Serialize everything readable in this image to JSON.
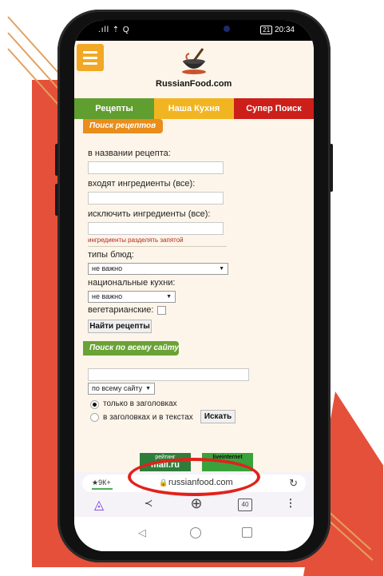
{
  "status_bar": {
    "signal": ".ıll ⇡ Q",
    "battery": "21",
    "time": "20:34"
  },
  "site": {
    "logo_text": "RussianFood.com",
    "nav_tabs": [
      "Рецепты",
      "Наша Кухня",
      "Супер Поиск"
    ],
    "search_recipes": {
      "title": "Поиск рецептов",
      "name_label": "в названии рецепта:",
      "ingredients_label": "входят ингредиенты (все):",
      "exclude_label": "исключить ингредиенты (все):",
      "hint": "ингредиенты разделять запятой",
      "dish_type_label": "типы блюд:",
      "dish_type_value": "не важно",
      "cuisine_label": "национальные кухни:",
      "cuisine_value": "не важно",
      "vegetarian_label": "вегетарианские:",
      "submit": "Найти рецепты"
    },
    "site_search": {
      "title": "Поиск по всему сайту",
      "scope_value": "по всему сайту",
      "radio_titles": "только в заголовках",
      "radio_titles_texts": "в заголовках и в текстах",
      "submit": "Искать"
    },
    "counters": [
      {
        "top": "рейтинг",
        "bottom": "mail.ru"
      },
      {
        "top": "liveinternet",
        "bottom": ""
      }
    ]
  },
  "browser": {
    "rating": "★9К+",
    "url": "russianfood.com",
    "tabs_count": "40"
  },
  "colors": {
    "accent_red": "#e5503a",
    "tab_green": "#5f9e2f",
    "tab_yellow": "#f2b522",
    "tab_red": "#cc1f1a",
    "annotation_oval": "#e2211c"
  }
}
